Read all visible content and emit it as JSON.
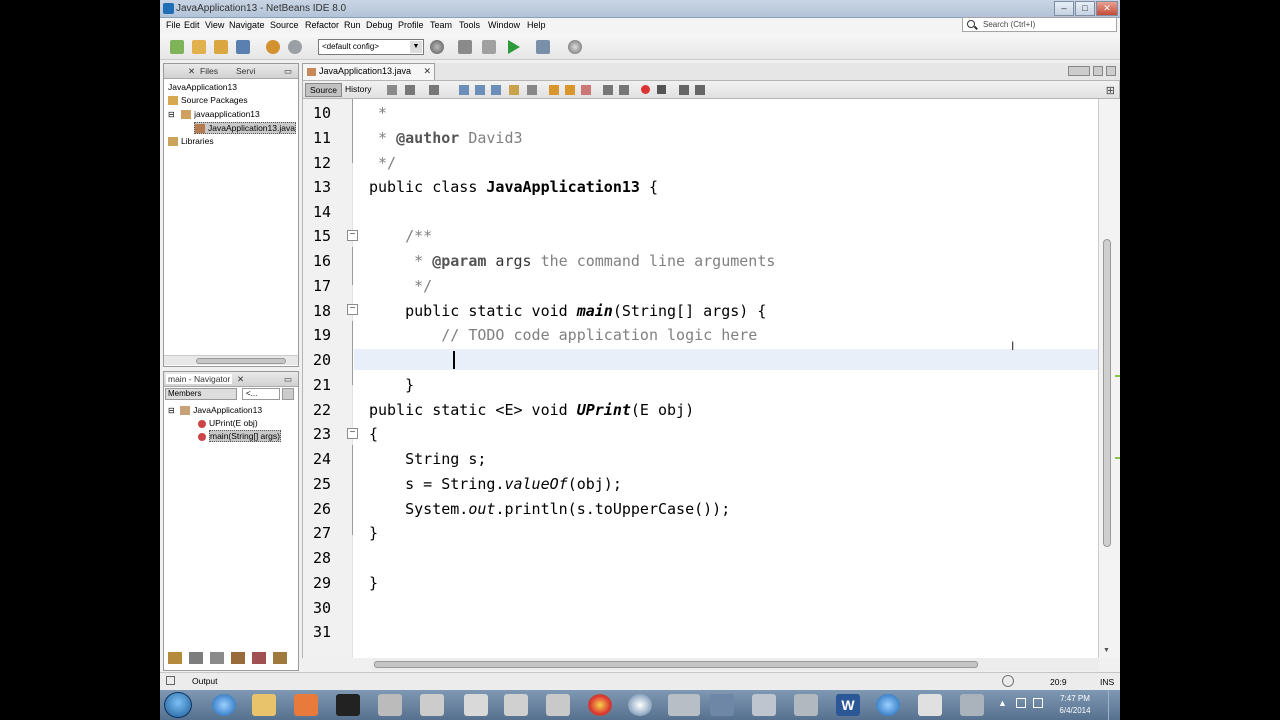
{
  "window": {
    "title": "JavaApplication13 - NetBeans IDE 8.0"
  },
  "menu": [
    "File",
    "Edit",
    "View",
    "Navigate",
    "Source",
    "Refactor",
    "Run",
    "Debug",
    "Profile",
    "Team",
    "Tools",
    "Window",
    "Help"
  ],
  "search": {
    "placeholder": "Search (Ctrl+I)"
  },
  "toolbar": {
    "config": "<default config>"
  },
  "projects_panel": {
    "tabs": [
      "Files",
      "Servi"
    ],
    "tree": [
      {
        "label": "JavaApplication13",
        "level": 0
      },
      {
        "label": "Source Packages",
        "level": 1
      },
      {
        "label": "javaapplication13",
        "level": 2
      },
      {
        "label": "JavaApplication13.java",
        "level": 3
      },
      {
        "label": "Libraries",
        "level": 1
      }
    ]
  },
  "navigator": {
    "title": "main - Navigator",
    "filter": "Members",
    "scope": "<...",
    "tree": [
      {
        "label": "JavaApplication13"
      },
      {
        "label": "UPrint(E obj)"
      },
      {
        "label": "main(String[] args)"
      }
    ]
  },
  "editor": {
    "tab": "JavaApplication13.java",
    "tabs": [
      "Source",
      "History"
    ],
    "line_numbers": [
      "10",
      "11",
      "12",
      "13",
      "14",
      "15",
      "16",
      "17",
      "18",
      "19",
      "20",
      "21",
      "22",
      "23",
      "24",
      "25",
      "26",
      "27",
      "28",
      "29",
      "30",
      "31"
    ],
    "lines": {
      "l10": " *",
      "l11a": " * ",
      "l11b": "@author",
      "l11c": " David3",
      "l12": " */",
      "l13a": "public class ",
      "l13b": "JavaApplication13",
      "l13c": " {",
      "l15": "    /**",
      "l16a": "     * ",
      "l16b": "@param",
      "l16c": " args",
      "l16d": " the command line arguments",
      "l17": "     */",
      "l18a": "    public static void ",
      "l18b": "main",
      "l18c": "(String[] args) {",
      "l19": "        // TODO code application logic here",
      "l21": "    }",
      "l22a": "public static <E> void ",
      "l22b": "UPrint",
      "l22c": "(E obj)",
      "l23": "{",
      "l24": "    String s;",
      "l25a": "    s = String.",
      "l25b": "valueOf",
      "l25c": "(obj);",
      "l26a": "    System.",
      "l26b": "out",
      "l26c": ".println(s.toUpperCase());",
      "l27": "}",
      "l29": "}"
    }
  },
  "output": {
    "label": "Output"
  },
  "status": {
    "position": "20:9",
    "mode": "INS"
  },
  "clock": {
    "time": "7:47 PM",
    "date": "6/4/2014"
  }
}
